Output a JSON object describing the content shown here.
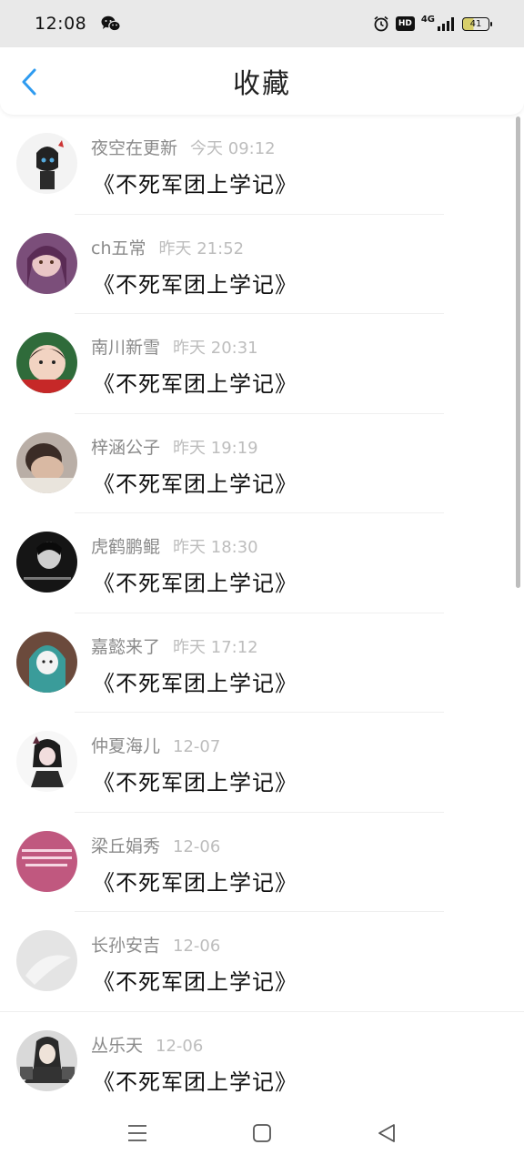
{
  "status_bar": {
    "time": "12:08",
    "network": "4G",
    "hd": "HD",
    "battery": "41"
  },
  "header": {
    "title": "收藏"
  },
  "items": [
    {
      "name": "夜空在更新",
      "time": "今天 09:12",
      "title": "《不死军团上学记》",
      "avatar_color": "#eeeeee"
    },
    {
      "name": "ch五常",
      "time": "昨天 21:52",
      "title": "《不死军团上学记》",
      "avatar_color": "#7b4e7a"
    },
    {
      "name": "南川新雪",
      "time": "昨天 20:31",
      "title": "《不死军团上学记》",
      "avatar_color": "#d8c4b4"
    },
    {
      "name": "梓涵公子",
      "time": "昨天 19:19",
      "title": "《不死军团上学记》",
      "avatar_color": "#9a8f88"
    },
    {
      "name": "虎鹤鹏鲲",
      "time": "昨天 18:30",
      "title": "《不死军团上学记》",
      "avatar_color": "#1b1b1b"
    },
    {
      "name": "嘉懿来了",
      "time": "昨天 17:12",
      "title": "《不死军团上学记》",
      "avatar_color": "#6b4a3c"
    },
    {
      "name": "仲夏海儿",
      "time": "12-07",
      "title": "《不死军团上学记》",
      "avatar_color": "#f4f4f4"
    },
    {
      "name": "梁丘娟秀",
      "time": "12-06",
      "title": "《不死军团上学记》",
      "avatar_color": "#c0587f"
    },
    {
      "name": "长孙安吉",
      "time": "12-06",
      "title": "《不死军团上学记》",
      "avatar_color": "#e6e6e6"
    },
    {
      "name": "丛乐天",
      "time": "12-06",
      "title": "《不死军团上学记》",
      "avatar_color": "#d9d9d9"
    }
  ],
  "colors": {
    "accent": "#2e9bf0"
  }
}
